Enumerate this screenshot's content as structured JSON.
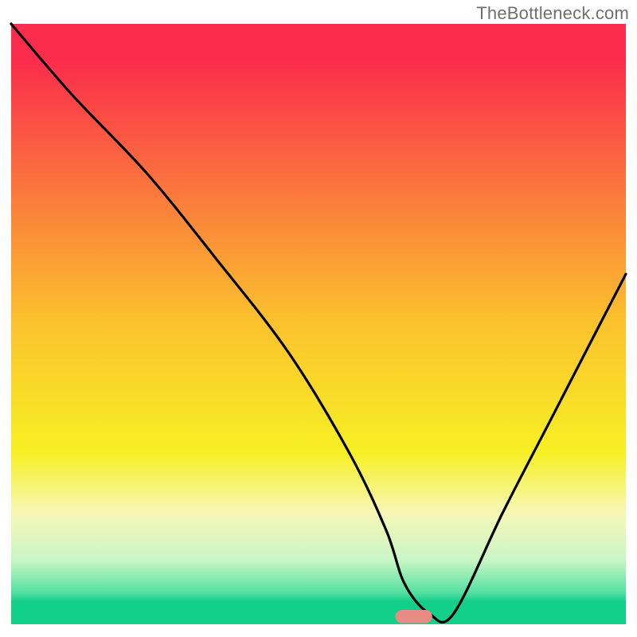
{
  "watermark": {
    "text": "TheBottleneck.com"
  },
  "chart_data": {
    "type": "line",
    "title": "",
    "xlabel": "",
    "ylabel": "",
    "xlim": [
      0,
      100
    ],
    "ylim": [
      0,
      100
    ],
    "background_gradient": {
      "stops": [
        {
          "offset": 0.0,
          "color": "#fb2c4c"
        },
        {
          "offset": 0.06,
          "color": "#fb2c4c"
        },
        {
          "offset": 0.5,
          "color": "#fbc22d"
        },
        {
          "offset": 0.72,
          "color": "#f7f024"
        },
        {
          "offset": 0.82,
          "color": "#f7f7b7"
        },
        {
          "offset": 0.9,
          "color": "#c9f6c6"
        },
        {
          "offset": 0.955,
          "color": "#54e0a0"
        },
        {
          "offset": 0.97,
          "color": "#12cf8a"
        },
        {
          "offset": 1.0,
          "color": "#12cf8a"
        }
      ]
    },
    "series": [
      {
        "name": "bottleneck-curve",
        "color": "#000000",
        "x": [
          0,
          10,
          22,
          33,
          45,
          55,
          61,
          64,
          68,
          72,
          80,
          88,
          96,
          100
        ],
        "y": [
          100,
          88,
          75,
          61,
          45,
          28,
          15,
          6,
          1,
          1,
          18,
          34,
          50,
          58
        ]
      }
    ],
    "marker": {
      "name": "optimal-region",
      "shape": "capsule",
      "color": "#e78b84",
      "x_center": 65.5,
      "y_center": 0.5,
      "width": 6.0,
      "height": 2.2
    },
    "notes": "Axes have no visible labels or ticks. y increases upward; x increases rightward. Values estimated from pixel positions on a 0-100 normalized scale for both axes. Curve starts at top-left, descends to a minimum near x≈68-72 (marker region), then rises toward right edge."
  }
}
